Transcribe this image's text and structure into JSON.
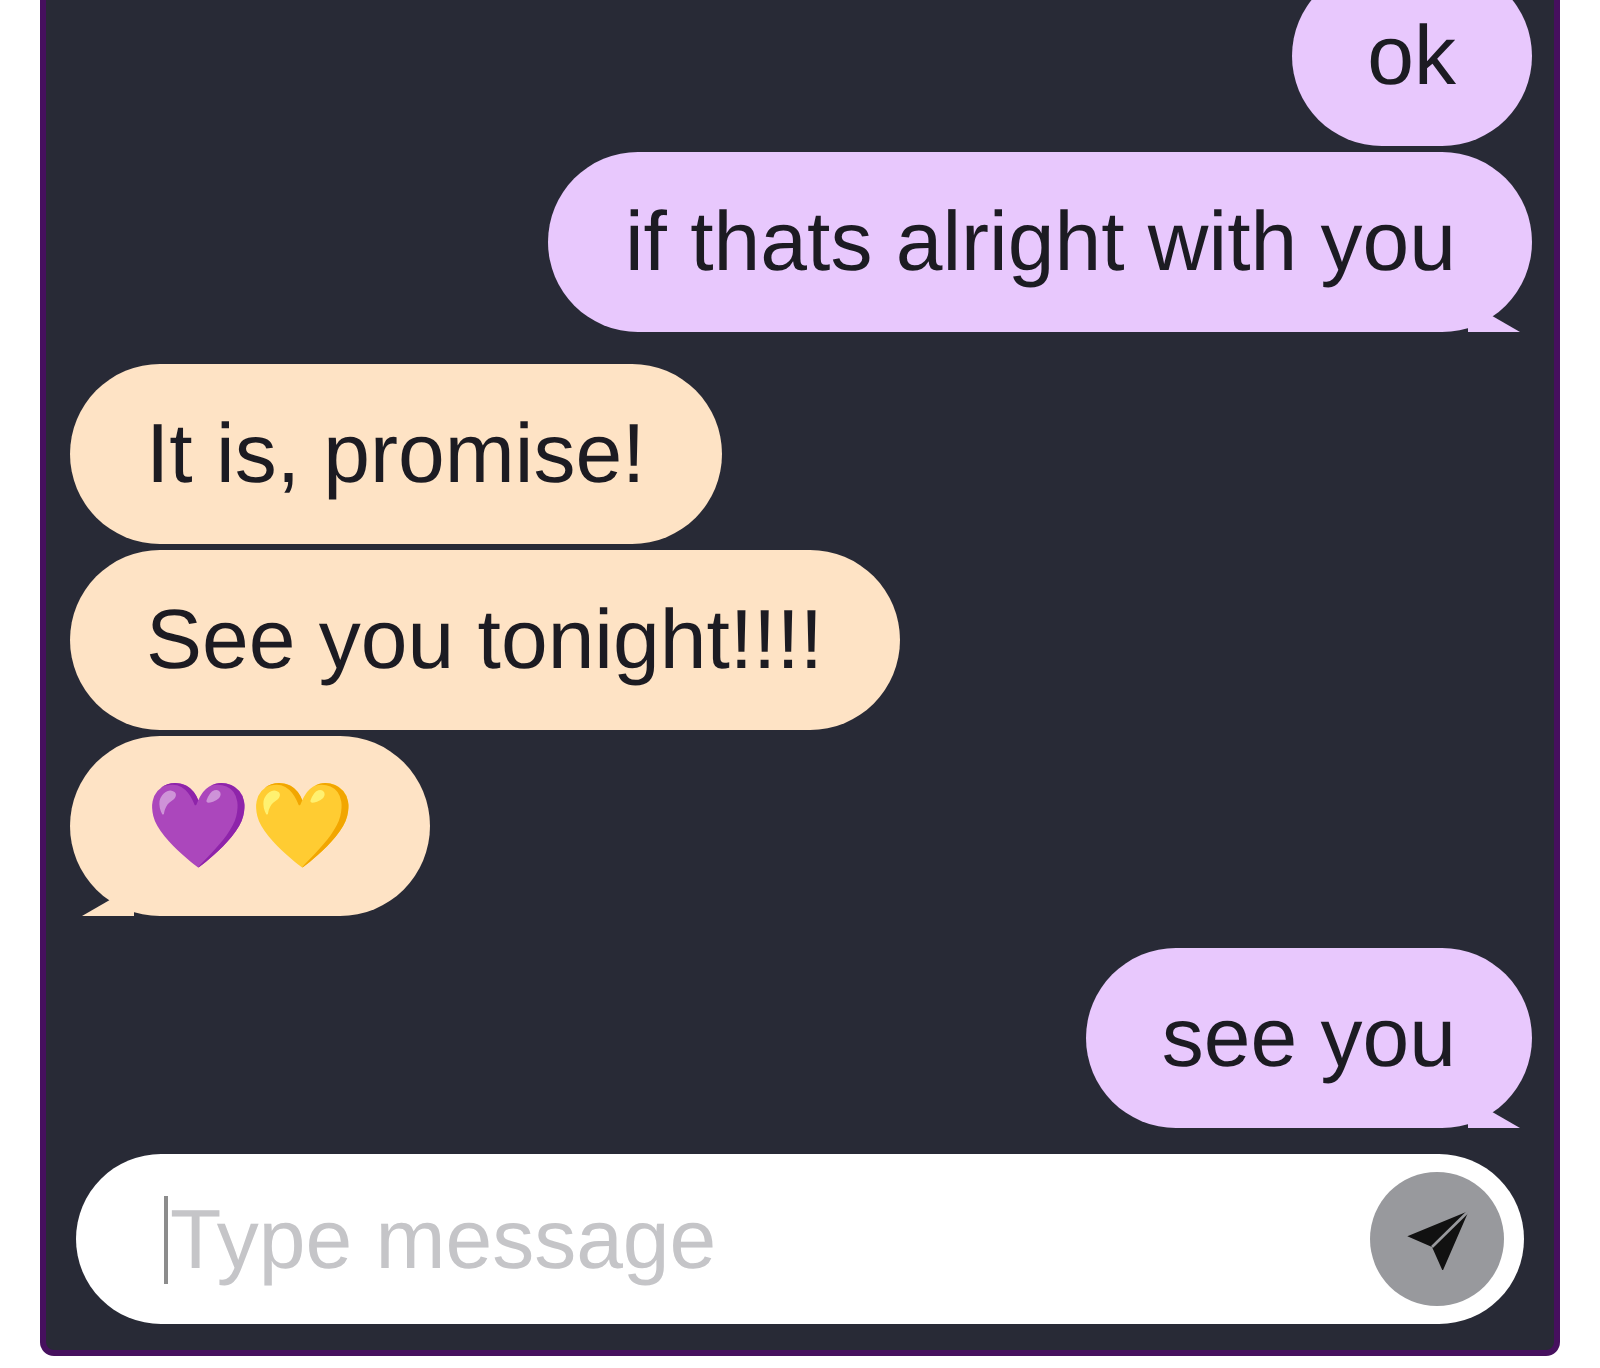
{
  "messages": [
    {
      "kind": "sent",
      "text": "ok"
    },
    {
      "kind": "sent",
      "text": "if thats alright with you"
    },
    {
      "kind": "received",
      "text": "It is, promise!"
    },
    {
      "kind": "received",
      "text": "See you tonight!!!!"
    },
    {
      "kind": "received",
      "text": "💜💛"
    },
    {
      "kind": "sent",
      "text": "see you"
    }
  ],
  "composer": {
    "placeholder": "Type message",
    "focused": true
  }
}
